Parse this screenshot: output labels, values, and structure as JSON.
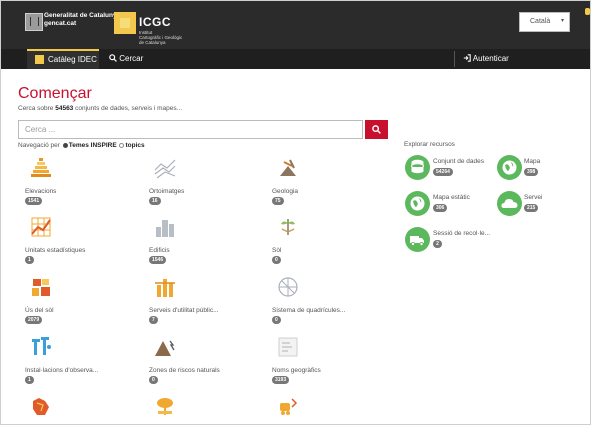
{
  "header": {
    "gen_line1": "Generalitat de Catalunya",
    "gen_line2": "gencat.cat",
    "icgc_title": "ICGC",
    "icgc_sub1": "Institut",
    "icgc_sub2": "Cartogràfic i Geològic",
    "icgc_sub3": "de Catalunya",
    "language": "Català",
    "language_caret": "▾"
  },
  "nav": {
    "tab_label": "Catàleg IDEC",
    "search_label": "Cercar",
    "auth_label": "Autenticar"
  },
  "main": {
    "title": "Començar",
    "lead_prefix": "Cerca sobre ",
    "lead_count": "54563",
    "lead_suffix": " conjunts de dades, serveis i mapes...",
    "search_placeholder": "Cerca ...",
    "nav_prefix": "Navegació per",
    "nav_opt1": "Temes INSPIRE",
    "nav_opt2": "topics"
  },
  "categories": [
    {
      "label": "Elevacions",
      "count": "1541",
      "icon": "elevation-icon"
    },
    {
      "label": "Ortoimatges",
      "count": "16",
      "icon": "orthoimage-icon"
    },
    {
      "label": "Geologia",
      "count": "75",
      "icon": "geology-icon"
    },
    {
      "label": "Unitats estadístiques",
      "count": "1",
      "icon": "statistics-icon"
    },
    {
      "label": "Edificis",
      "count": "1546",
      "icon": "buildings-icon"
    },
    {
      "label": "Sòl",
      "count": "0",
      "icon": "soil-icon"
    },
    {
      "label": "Ús del sòl",
      "count": "2079",
      "icon": "land-use-icon"
    },
    {
      "label": "Serveis d'utilitat públic...",
      "count": "7",
      "icon": "utility-services-icon"
    },
    {
      "label": "Sistema de quadrícules...",
      "count": "0",
      "icon": "grid-system-icon"
    },
    {
      "label": "Instal·lacions d'observa...",
      "count": "1",
      "icon": "observation-icon"
    },
    {
      "label": "Zones de riscos naturals",
      "count": "0",
      "icon": "natural-risk-icon"
    },
    {
      "label": "Noms geogràfics",
      "count": "3193",
      "icon": "geographic-names-icon"
    }
  ],
  "bottom_icons": [
    "regions-icon",
    "land-cover-icon",
    "transport-icon"
  ],
  "explore": {
    "title": "Explorar recursos",
    "resources": [
      {
        "label": "Conjunt de dades",
        "count": "54264",
        "icon": "database-icon"
      },
      {
        "label": "Mapa",
        "count": "398",
        "icon": "globe-icon"
      },
      {
        "label": "Mapa estàtic",
        "count": "306",
        "icon": "static-map-icon"
      },
      {
        "label": "Servei",
        "count": "215",
        "icon": "cloud-icon"
      },
      {
        "label": "Sessió de recol·le...",
        "count": "2",
        "icon": "truck-icon"
      }
    ]
  },
  "colors": {
    "accent": "#c8102e",
    "brand_yellow": "#f2c94c",
    "resource_green": "#5cb85c",
    "topbar": "#2b2b2b"
  }
}
